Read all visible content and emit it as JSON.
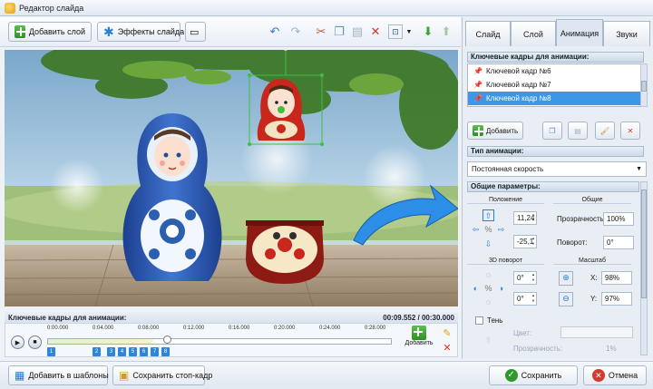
{
  "window": {
    "title": "Редактор слайда"
  },
  "toolbar": {
    "add_layer": "Добавить слой",
    "slide_effects": "Эффекты слайда"
  },
  "canvas": {
    "description_free": true
  },
  "keyframes_bar": {
    "title": "Ключевые кадры для анимации:",
    "time": "00:09.552 / 00:30.000"
  },
  "timeline": {
    "ticks": [
      "0:00.000",
      "0:04.000",
      "0:08.000",
      "0:12.000",
      "0:16.000",
      "0:20.000",
      "0:24.000",
      "0:28.000"
    ],
    "markers": [
      "1",
      "2",
      "3",
      "4",
      "5",
      "6",
      "7",
      "8"
    ],
    "add_label": "Добавить"
  },
  "bottom": {
    "add_templates": "Добавить в шаблоны",
    "save_frame": "Сохранить стоп-кадр",
    "save": "Сохранить",
    "cancel": "Отмена"
  },
  "panel": {
    "tabs": [
      {
        "label": "Слайд"
      },
      {
        "label": "Слой"
      },
      {
        "label": "Анимация"
      },
      {
        "label": "Звуки"
      }
    ],
    "kf_header": "Ключевые кадры для анимации:",
    "kf_items": [
      {
        "label": "Ключевой кадр №6"
      },
      {
        "label": "Ключевой кадр №7"
      },
      {
        "label": "Ключевой кадр №8"
      }
    ],
    "add_button": "Добавить",
    "anim_type_header": "Тип анимации:",
    "anim_type_value": "Постоянная скорость",
    "params_header": "Общие параметры:",
    "position_label": "Положение",
    "position_x": "11,24",
    "position_y": "-25,1",
    "general_label": "Общие",
    "transparency_label": "Прозрачность:",
    "transparency_value": "100%",
    "rotation_label": "Поворот:",
    "rotation_value": "0°",
    "rot3d_label": "3D поворот",
    "rot3d_x": "0°",
    "rot3d_y": "0°",
    "scale_label": "Масштаб",
    "scale_x_label": "X:",
    "scale_x": "98%",
    "scale_y_label": "Y:",
    "scale_y": "97%",
    "shadow_label": "Тень",
    "color_label": "Цвет:",
    "shadow_transparency_label": "Прозрачность:",
    "shadow_transparency_value": "1%"
  },
  "colors": {
    "accent": "#3c97e8",
    "save_green": "#2f9a2a",
    "cancel_red": "#d23b2f"
  }
}
